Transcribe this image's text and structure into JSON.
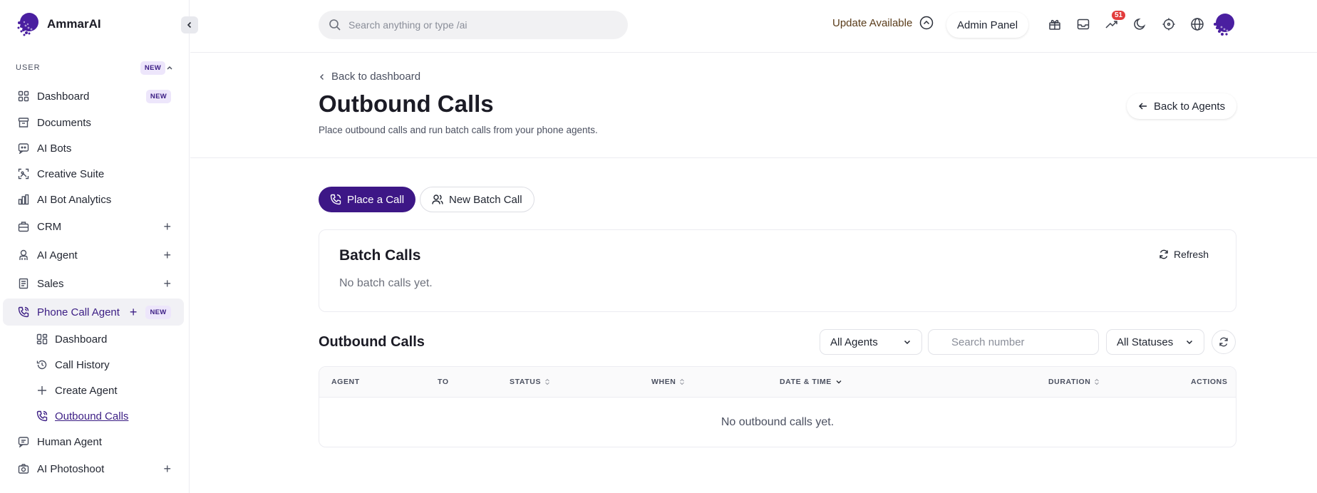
{
  "brand": {
    "name": "AmmarAI"
  },
  "sidebar": {
    "section_label": "USER",
    "section_badge": "NEW",
    "items": [
      {
        "label": "Dashboard",
        "badge": "NEW",
        "icon": "grid-icon"
      },
      {
        "label": "Documents",
        "icon": "archive-icon"
      },
      {
        "label": "AI Bots",
        "icon": "chat-bot-icon"
      },
      {
        "label": "Creative Suite",
        "icon": "image-frame-icon"
      },
      {
        "label": "AI Bot Analytics",
        "icon": "bar-chart-icon"
      },
      {
        "label": "CRM",
        "icon": "briefcase-icon",
        "expand": "+"
      },
      {
        "label": "AI Agent",
        "icon": "agent-icon",
        "expand": "+"
      },
      {
        "label": "Sales",
        "icon": "receipt-icon",
        "expand": "+"
      },
      {
        "label": "Phone Call Agent",
        "icon": "phone-icon",
        "expand": "+",
        "badge": "NEW"
      },
      {
        "label": "Human Agent",
        "icon": "message-icon"
      },
      {
        "label": "AI Photoshoot",
        "icon": "camera-icon",
        "expand": "+"
      }
    ],
    "sub_items": [
      {
        "label": "Dashboard",
        "icon": "grid-icon"
      },
      {
        "label": "Call History",
        "icon": "history-icon"
      },
      {
        "label": "Create Agent",
        "icon": "plus-icon"
      },
      {
        "label": "Outbound Calls",
        "icon": "phone-outgoing-icon"
      }
    ]
  },
  "topbar": {
    "search_placeholder": "Search anything or type /ai",
    "update_label": "Update Available",
    "admin_label": "Admin Panel",
    "notification_count": "51"
  },
  "header": {
    "back_label": "Back to dashboard",
    "title": "Outbound Calls",
    "subtitle": "Place outbound calls and run batch calls from your phone agents.",
    "back_agents_label": "Back to Agents"
  },
  "actions": {
    "place_call": "Place a Call",
    "new_batch": "New Batch Call"
  },
  "batch": {
    "title": "Batch Calls",
    "refresh": "Refresh",
    "empty": "No batch calls yet."
  },
  "outbound": {
    "title": "Outbound Calls",
    "agent_filter": "All Agents",
    "search_placeholder": "Search number",
    "status_filter": "All Statuses",
    "columns": [
      "AGENT",
      "TO",
      "STATUS",
      "WHEN",
      "DATE & TIME",
      "DURATION",
      "ACTIONS"
    ],
    "empty": "No outbound calls yet."
  },
  "colors": {
    "accent": "#3d1786",
    "badge_bg": "#ede6fb",
    "notification": "#e23c3c"
  }
}
